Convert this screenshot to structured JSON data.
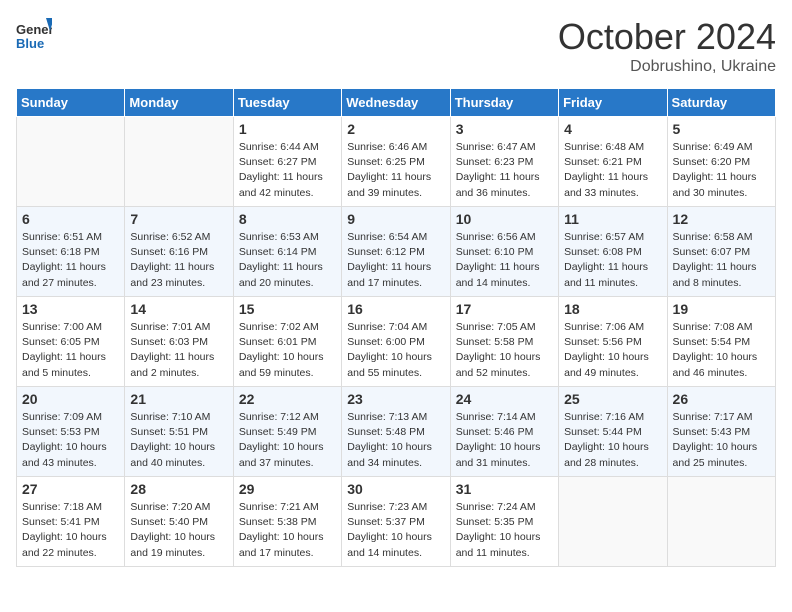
{
  "header": {
    "logo_line1": "General",
    "logo_line2": "Blue",
    "month": "October 2024",
    "location": "Dobrushino, Ukraine"
  },
  "weekdays": [
    "Sunday",
    "Monday",
    "Tuesday",
    "Wednesday",
    "Thursday",
    "Friday",
    "Saturday"
  ],
  "weeks": [
    [
      {
        "day": "",
        "info": ""
      },
      {
        "day": "",
        "info": ""
      },
      {
        "day": "1",
        "info": "Sunrise: 6:44 AM\nSunset: 6:27 PM\nDaylight: 11 hours and 42 minutes."
      },
      {
        "day": "2",
        "info": "Sunrise: 6:46 AM\nSunset: 6:25 PM\nDaylight: 11 hours and 39 minutes."
      },
      {
        "day": "3",
        "info": "Sunrise: 6:47 AM\nSunset: 6:23 PM\nDaylight: 11 hours and 36 minutes."
      },
      {
        "day": "4",
        "info": "Sunrise: 6:48 AM\nSunset: 6:21 PM\nDaylight: 11 hours and 33 minutes."
      },
      {
        "day": "5",
        "info": "Sunrise: 6:49 AM\nSunset: 6:20 PM\nDaylight: 11 hours and 30 minutes."
      }
    ],
    [
      {
        "day": "6",
        "info": "Sunrise: 6:51 AM\nSunset: 6:18 PM\nDaylight: 11 hours and 27 minutes."
      },
      {
        "day": "7",
        "info": "Sunrise: 6:52 AM\nSunset: 6:16 PM\nDaylight: 11 hours and 23 minutes."
      },
      {
        "day": "8",
        "info": "Sunrise: 6:53 AM\nSunset: 6:14 PM\nDaylight: 11 hours and 20 minutes."
      },
      {
        "day": "9",
        "info": "Sunrise: 6:54 AM\nSunset: 6:12 PM\nDaylight: 11 hours and 17 minutes."
      },
      {
        "day": "10",
        "info": "Sunrise: 6:56 AM\nSunset: 6:10 PM\nDaylight: 11 hours and 14 minutes."
      },
      {
        "day": "11",
        "info": "Sunrise: 6:57 AM\nSunset: 6:08 PM\nDaylight: 11 hours and 11 minutes."
      },
      {
        "day": "12",
        "info": "Sunrise: 6:58 AM\nSunset: 6:07 PM\nDaylight: 11 hours and 8 minutes."
      }
    ],
    [
      {
        "day": "13",
        "info": "Sunrise: 7:00 AM\nSunset: 6:05 PM\nDaylight: 11 hours and 5 minutes."
      },
      {
        "day": "14",
        "info": "Sunrise: 7:01 AM\nSunset: 6:03 PM\nDaylight: 11 hours and 2 minutes."
      },
      {
        "day": "15",
        "info": "Sunrise: 7:02 AM\nSunset: 6:01 PM\nDaylight: 10 hours and 59 minutes."
      },
      {
        "day": "16",
        "info": "Sunrise: 7:04 AM\nSunset: 6:00 PM\nDaylight: 10 hours and 55 minutes."
      },
      {
        "day": "17",
        "info": "Sunrise: 7:05 AM\nSunset: 5:58 PM\nDaylight: 10 hours and 52 minutes."
      },
      {
        "day": "18",
        "info": "Sunrise: 7:06 AM\nSunset: 5:56 PM\nDaylight: 10 hours and 49 minutes."
      },
      {
        "day": "19",
        "info": "Sunrise: 7:08 AM\nSunset: 5:54 PM\nDaylight: 10 hours and 46 minutes."
      }
    ],
    [
      {
        "day": "20",
        "info": "Sunrise: 7:09 AM\nSunset: 5:53 PM\nDaylight: 10 hours and 43 minutes."
      },
      {
        "day": "21",
        "info": "Sunrise: 7:10 AM\nSunset: 5:51 PM\nDaylight: 10 hours and 40 minutes."
      },
      {
        "day": "22",
        "info": "Sunrise: 7:12 AM\nSunset: 5:49 PM\nDaylight: 10 hours and 37 minutes."
      },
      {
        "day": "23",
        "info": "Sunrise: 7:13 AM\nSunset: 5:48 PM\nDaylight: 10 hours and 34 minutes."
      },
      {
        "day": "24",
        "info": "Sunrise: 7:14 AM\nSunset: 5:46 PM\nDaylight: 10 hours and 31 minutes."
      },
      {
        "day": "25",
        "info": "Sunrise: 7:16 AM\nSunset: 5:44 PM\nDaylight: 10 hours and 28 minutes."
      },
      {
        "day": "26",
        "info": "Sunrise: 7:17 AM\nSunset: 5:43 PM\nDaylight: 10 hours and 25 minutes."
      }
    ],
    [
      {
        "day": "27",
        "info": "Sunrise: 7:18 AM\nSunset: 5:41 PM\nDaylight: 10 hours and 22 minutes."
      },
      {
        "day": "28",
        "info": "Sunrise: 7:20 AM\nSunset: 5:40 PM\nDaylight: 10 hours and 19 minutes."
      },
      {
        "day": "29",
        "info": "Sunrise: 7:21 AM\nSunset: 5:38 PM\nDaylight: 10 hours and 17 minutes."
      },
      {
        "day": "30",
        "info": "Sunrise: 7:23 AM\nSunset: 5:37 PM\nDaylight: 10 hours and 14 minutes."
      },
      {
        "day": "31",
        "info": "Sunrise: 7:24 AM\nSunset: 5:35 PM\nDaylight: 10 hours and 11 minutes."
      },
      {
        "day": "",
        "info": ""
      },
      {
        "day": "",
        "info": ""
      }
    ]
  ]
}
